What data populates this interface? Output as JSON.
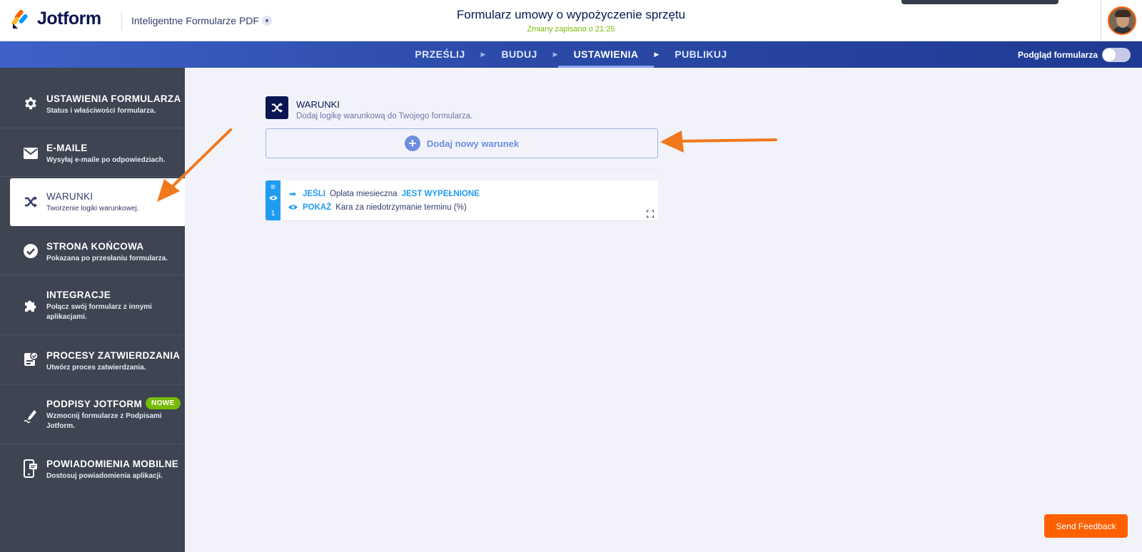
{
  "header": {
    "logo_text": "Jotform",
    "product_select": "Inteligentne Formularze PDF",
    "form_title": "Formularz umowy o wypożyczenie sprzętu",
    "saved_status": "Zmiany zapisano o 21:25"
  },
  "nav": {
    "tabs": [
      "PRZEŚLIJ",
      "BUDUJ",
      "USTAWIENIA",
      "PUBLIKUJ"
    ],
    "active_tab": "USTAWIENIA",
    "preview_label": "Podgląd formularza",
    "preview_enabled": false
  },
  "sidebar": {
    "items": [
      {
        "title": "USTAWIENIA FORMULARZA",
        "desc": "Status i właściwości formularza.",
        "icon": "gear-icon"
      },
      {
        "title": "E-MAILE",
        "desc": "Wysyłaj e-maile po odpowiedziach.",
        "icon": "envelope-icon"
      },
      {
        "title": "WARUNKI",
        "desc": "Tworzenie logiki warunkowej.",
        "icon": "shuffle-icon",
        "active": true
      },
      {
        "title": "STRONA KOŃCOWA",
        "desc": "Pokazana po przesłaniu formularza.",
        "icon": "check-circle-icon"
      },
      {
        "title": "INTEGRACJE",
        "desc": "Połącz swój formularz z innymi aplikacjami.",
        "icon": "puzzle-icon"
      },
      {
        "title": "PROCESY ZATWIERDZANIA",
        "desc": "Utwórz proces zatwierdzania.",
        "icon": "approval-icon"
      },
      {
        "title": "PODPISY JOTFORM",
        "desc": "Wzmocnij formularze z Podpisami Jotform.",
        "icon": "signature-pen-icon",
        "badge": "NOWE"
      },
      {
        "title": "POWIADOMIENIA MOBILNE",
        "desc": "Dostosuj powiadomienia aplikacji.",
        "icon": "mobile-notification-icon"
      }
    ]
  },
  "main": {
    "section_title": "WARUNKI",
    "section_desc": "Dodaj logikę warunkową do Twojego formularza.",
    "add_button_label": "Dodaj nowy warunek",
    "conditions": [
      {
        "index": "1",
        "if_keyword": "JEŚLI",
        "if_field": "Oplata miesieczna",
        "if_state": "JEST WYPEŁNIONE",
        "then_keyword": "POKAŻ",
        "then_field": "Kara za niedotrzymanie terminu (%)"
      }
    ]
  },
  "feedback_label": "Send Feedback",
  "colors": {
    "brand_navy": "#0a1551",
    "accent_blue": "#1f9cf0",
    "saved_green": "#78bb07",
    "feedback_orange": "#ff6100",
    "annotation_arrow": "#f2781c"
  }
}
